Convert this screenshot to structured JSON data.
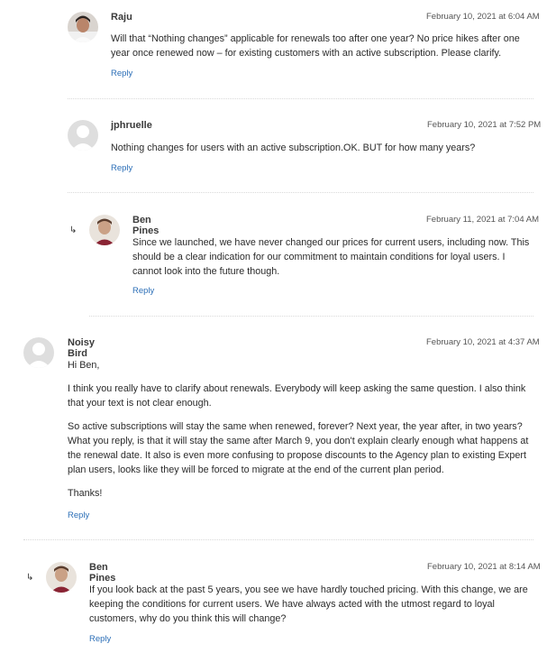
{
  "comments": [
    {
      "author": "Raju",
      "date": "February 10, 2021 at 6:04 AM",
      "paragraphs": [
        "Will that “Nothing changes” applicable for renewals too after one year? No price hikes after one year once renewed now – for existing customers with an active subscription. Please clarify."
      ],
      "reply_label": "Reply",
      "avatar": "photo-avatar-raju"
    },
    {
      "author": "jphruelle",
      "date": "February 10, 2021 at 7:52 PM",
      "paragraphs": [
        "Nothing changes for users with an active subscription.OK. BUT for how many years?"
      ],
      "reply_label": "Reply",
      "avatar": "default-avatar-icon"
    },
    {
      "author": "Ben Pines",
      "date": "February 11, 2021 at 7:04 AM",
      "paragraphs": [
        "Since we launched, we have never changed our prices for current users, including now. This should be a clear indication for our commitment to maintain conditions for loyal users. I cannot look into the future though."
      ],
      "reply_label": "Reply",
      "avatar": "photo-avatar-ben",
      "is_reply": true
    },
    {
      "author": "Noisy Bird",
      "date": "February 10, 2021 at 4:37 AM",
      "paragraphs": [
        "Hi Ben,",
        "I think you really have to clarify about renewals. Everybody will keep asking the same question. I also think that your text is not clear enough.",
        "So active subscriptions will stay the same when renewed, forever? Next year, the year after, in two years? What you reply, is that it will stay the same after March 9, you don't explain clearly enough what happens at the renewal date. It also is even more confusing to propose discounts to the Agency plan to existing Expert plan users, looks like they will be forced to migrate at the end of the current plan period.",
        "Thanks!"
      ],
      "reply_label": "Reply",
      "avatar": "default-avatar-icon"
    },
    {
      "author": "Ben Pines",
      "date": "February 10, 2021 at 8:14 AM",
      "paragraphs": [
        "If you look back at the past 5 years, you see we have hardly touched pricing. With this change, we are keeping the conditions for current users. We have always acted with the utmost regard to loyal customers, why do you think this will change?"
      ],
      "reply_label": "Reply",
      "avatar": "photo-avatar-ben",
      "is_reply": true
    }
  ],
  "reply_arrow": "↳"
}
